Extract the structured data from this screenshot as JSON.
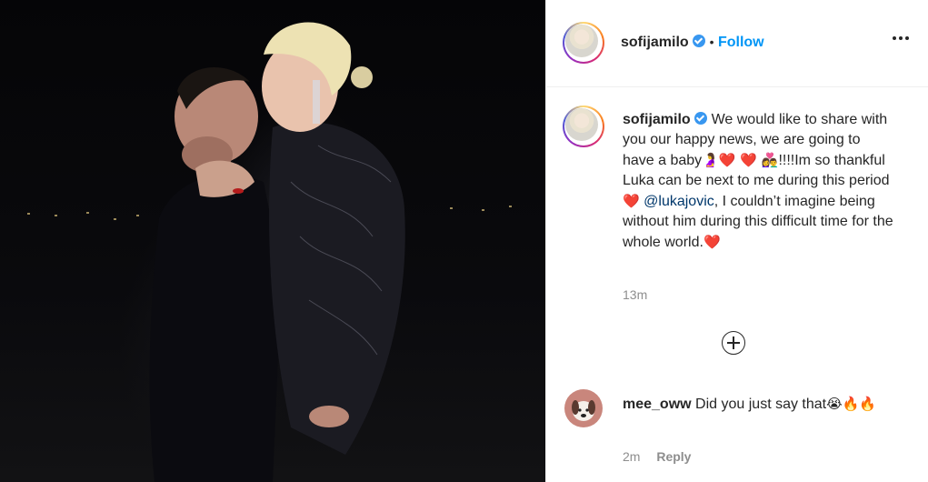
{
  "post": {
    "username": "sofijamilo",
    "follow_label": "Follow",
    "separator": "•",
    "caption_text": "We would like to share with you our happy news, we are going to have a baby",
    "caption_emoji_1": "🤰❤️ ❤️  👩‍❤️‍👨",
    "caption_text_2": "!!!!Im so thankful Luka can be next to me during this period",
    "caption_emoji_2": "❤️",
    "mention": "@lukajovic",
    "caption_text_3": ", I couldn’t imagine being without him during this difficult time for the whole world.",
    "caption_emoji_3": "❤️",
    "time": "13m"
  },
  "comment": {
    "username": "mee_oww",
    "text": "Did you just say that",
    "emoji": "😭🔥🔥",
    "time": "2m",
    "reply_label": "Reply"
  },
  "colors": {
    "follow": "#0095f6",
    "verified": "#3897f0",
    "mention": "#00376b",
    "muted": "#8e8e8e"
  },
  "icons": {
    "verified": "verified-badge-icon",
    "more": "more-options-icon",
    "add": "add-circle-icon"
  }
}
